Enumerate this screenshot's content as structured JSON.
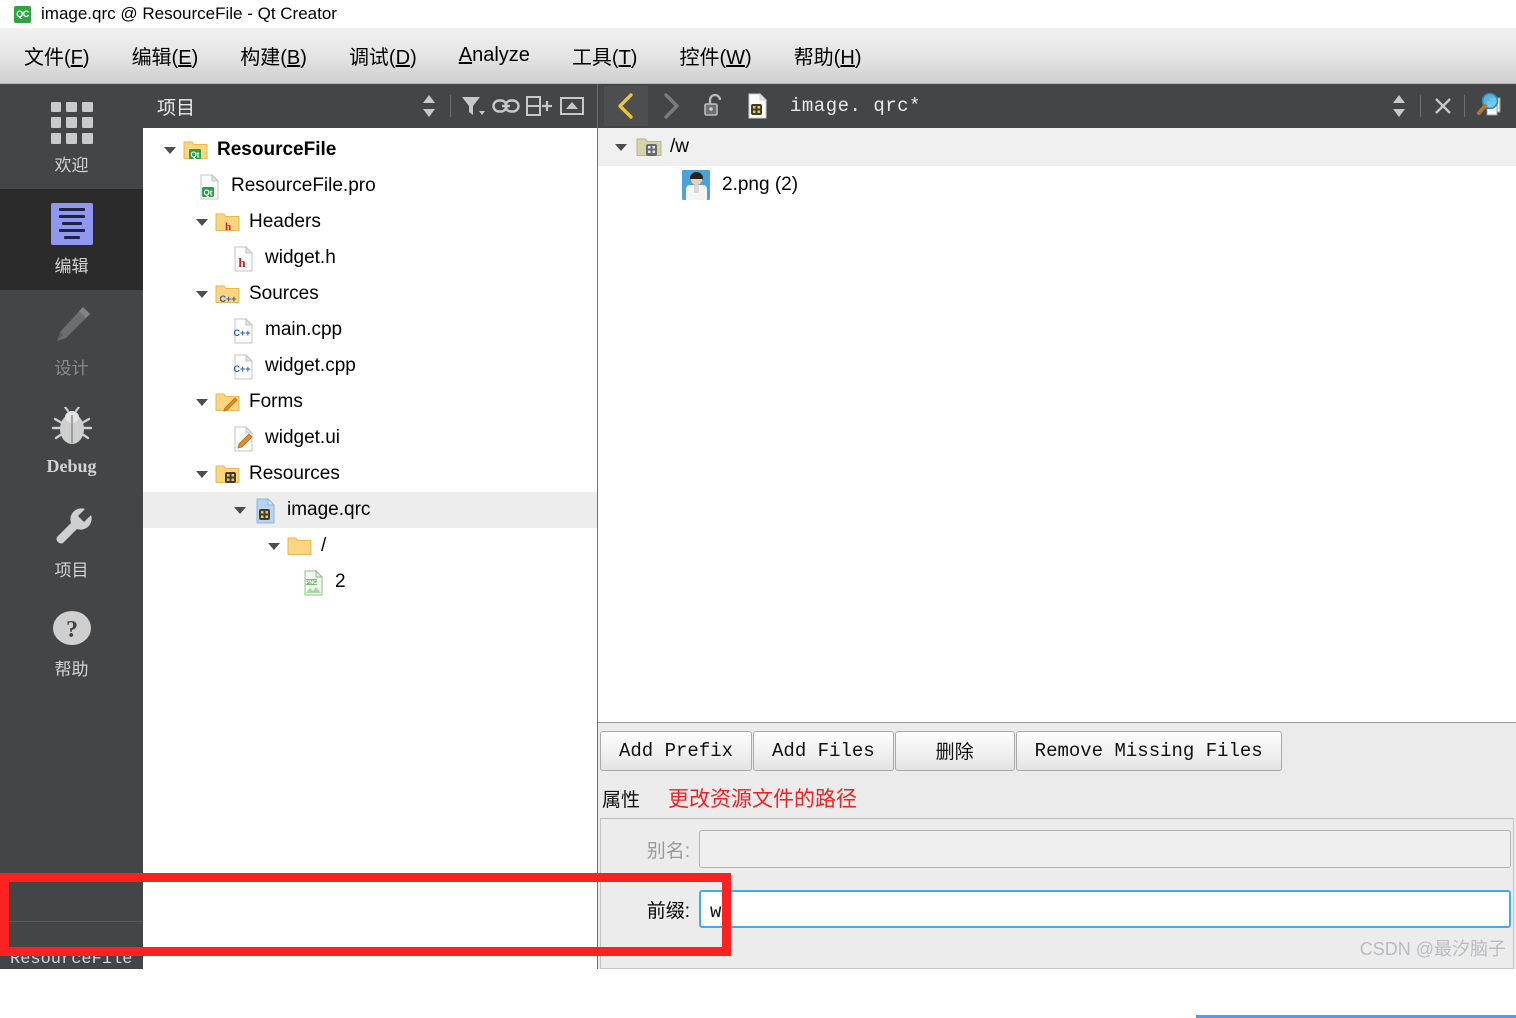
{
  "window": {
    "title": "image.qrc @ ResourceFile - Qt Creator",
    "logo_text": "QC"
  },
  "menubar": [
    {
      "label_pre": "文件(",
      "key": "F",
      "label_post": ")"
    },
    {
      "label_pre": "编辑(",
      "key": "E",
      "label_post": ")"
    },
    {
      "label_pre": "构建(",
      "key": "B",
      "label_post": ")"
    },
    {
      "label_pre": "调试(",
      "key": "D",
      "label_post": ")"
    },
    {
      "label_pre": "",
      "key": "A",
      "label_post": "nalyze"
    },
    {
      "label_pre": "工具(",
      "key": "T",
      "label_post": ")"
    },
    {
      "label_pre": "控件(",
      "key": "W",
      "label_post": ")"
    },
    {
      "label_pre": "帮助(",
      "key": "H",
      "label_post": ")"
    }
  ],
  "modebar": {
    "items": [
      {
        "label": "欢迎",
        "icon": "grid-icon",
        "state": "normal"
      },
      {
        "label": "编辑",
        "icon": "editor-icon",
        "state": "selected"
      },
      {
        "label": "设计",
        "icon": "pencil-icon",
        "state": "disabled"
      },
      {
        "label": "Debug",
        "icon": "bug-icon",
        "state": "normal"
      },
      {
        "label": "项目",
        "icon": "wrench-icon",
        "state": "normal"
      },
      {
        "label": "帮助",
        "icon": "question-icon",
        "state": "normal"
      }
    ],
    "kit_name": "ResourceFile"
  },
  "project_panel": {
    "title": "项目",
    "toolbar": [
      {
        "name": "sync-stepper-icon"
      },
      {
        "name": "filter-icon"
      },
      {
        "name": "link-icon"
      },
      {
        "name": "split-add-icon"
      },
      {
        "name": "minimize-icon"
      }
    ],
    "tree": [
      {
        "label": "ResourceFile",
        "icon": "qt-folder-icon",
        "indent": 0,
        "arrow": "down",
        "bold": true,
        "selected": false
      },
      {
        "label": "ResourceFile.pro",
        "icon": "qt-file-icon",
        "indent": 1,
        "arrow": "none",
        "bold": false,
        "selected": false
      },
      {
        "label": "Headers",
        "icon": "h-folder-icon",
        "indent": 1,
        "arrow": "down",
        "bold": false,
        "selected": false
      },
      {
        "label": "widget.h",
        "icon": "h-file-icon",
        "indent": 2,
        "arrow": "none",
        "bold": false,
        "selected": false
      },
      {
        "label": "Sources",
        "icon": "cpp-folder-icon",
        "indent": 1,
        "arrow": "down",
        "bold": false,
        "selected": false
      },
      {
        "label": "main.cpp",
        "icon": "cpp-file-icon",
        "indent": 2,
        "arrow": "none",
        "bold": false,
        "selected": false
      },
      {
        "label": "widget.cpp",
        "icon": "cpp-file-icon",
        "indent": 2,
        "arrow": "none",
        "bold": false,
        "selected": false
      },
      {
        "label": "Forms",
        "icon": "form-folder-icon",
        "indent": 1,
        "arrow": "down",
        "bold": false,
        "selected": false
      },
      {
        "label": "widget.ui",
        "icon": "form-file-icon",
        "indent": 2,
        "arrow": "none",
        "bold": false,
        "selected": false
      },
      {
        "label": "Resources",
        "icon": "qrc-folder-icon",
        "indent": 1,
        "arrow": "down",
        "bold": false,
        "selected": false
      },
      {
        "label": "image.qrc",
        "icon": "qrc-file-icon",
        "indent": 2,
        "arrow": "down",
        "bold": false,
        "selected": true
      },
      {
        "label": "/",
        "icon": "plain-folder-icon",
        "indent": 3,
        "arrow": "down",
        "bold": false,
        "selected": false
      },
      {
        "label": "2",
        "icon": "png-file-icon",
        "indent": 4,
        "arrow": "none",
        "bold": false,
        "selected": false
      }
    ]
  },
  "editor": {
    "toolbar": {
      "back_icon": "chevron-left-icon",
      "forward_icon": "chevron-right-icon",
      "lock_icon": "unlocked-icon",
      "doc_icon": "qrc-file-icon",
      "filename": "image. qrc*",
      "stepper_icon": "updown-stepper-icon",
      "close_icon": "close-icon",
      "split_icon": "search-documents-icon"
    },
    "resource_tree": [
      {
        "label": "/w",
        "icon": "qrc-folder-icon",
        "type": "prefix",
        "arrow": "down"
      },
      {
        "label": "2.png (2)",
        "icon": "image-thumbnail",
        "type": "file",
        "arrow": "none"
      }
    ],
    "buttons": [
      {
        "label": "Add Prefix",
        "style": "mono"
      },
      {
        "label": "Add Files",
        "style": "mono"
      },
      {
        "label": "删除",
        "style": "cn"
      },
      {
        "label": "Remove Missing Files",
        "style": "mono"
      }
    ],
    "properties": {
      "title": "属性",
      "annotation": "更改资源文件的路径",
      "fields": [
        {
          "label": "别名:",
          "value": "",
          "disabled": true,
          "focused": false
        },
        {
          "label": "前缀:",
          "value": "w",
          "disabled": false,
          "focused": true
        }
      ]
    }
  },
  "watermark": "CSDN @最汐脑子",
  "colors": {
    "mode_bar": "#444546",
    "mode_selected": "#2b2b2c",
    "accent_blue": "#3daee9",
    "annotation_red": "#ee2222",
    "highlight_box_red": "#fd2222",
    "qt_green": "#2fa33d"
  }
}
